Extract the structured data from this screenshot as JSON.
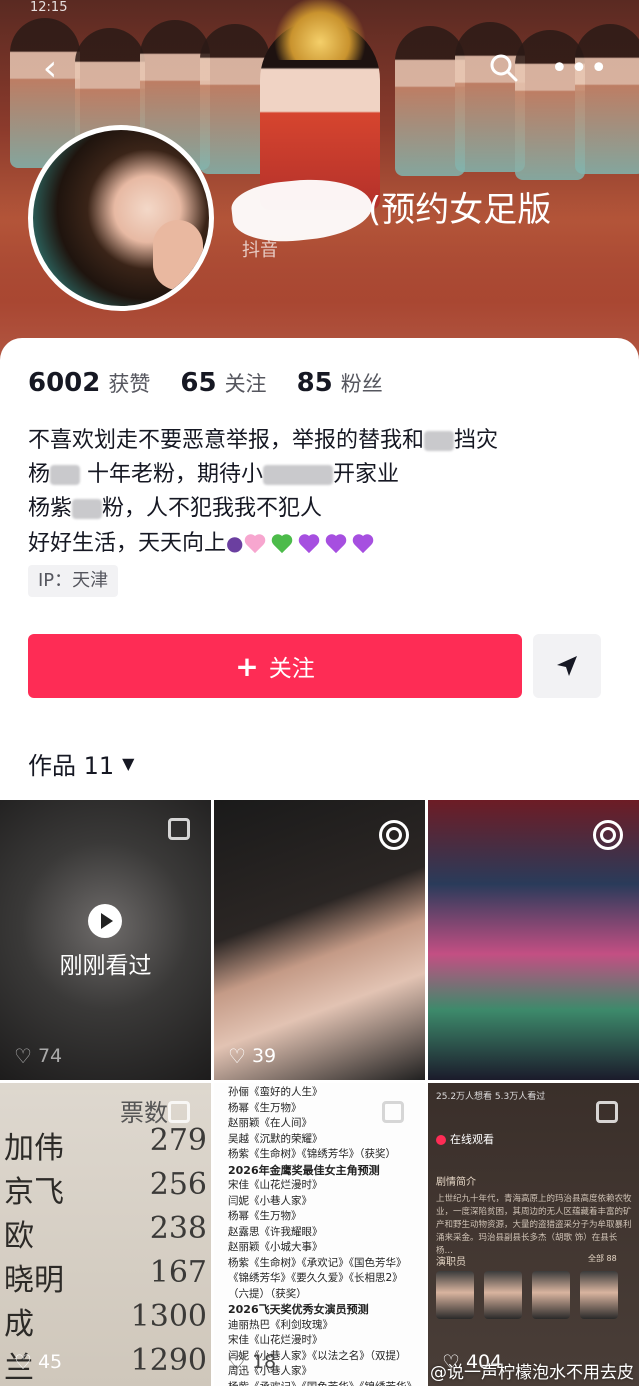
{
  "status_bar": {
    "time": "12:15"
  },
  "profile": {
    "nickname_suffix": "(预约女足版",
    "platform_tag": "抖音",
    "stats": [
      {
        "value": "6002",
        "label": "获赞"
      },
      {
        "value": "65",
        "label": "关注"
      },
      {
        "value": "85",
        "label": "粉丝"
      }
    ],
    "bio": {
      "line1": "不喜欢划走不要恶意举报，举报的替我和",
      "line1_end": "挡灾",
      "line2_start": "杨",
      "line2_mid": " 十年老粉，期待小",
      "line2_end": "开家业",
      "line3_start": "杨紫",
      "line3_end": "粉，人不犯我我不犯人",
      "line4": "好好生活，天天向上"
    },
    "ip": "IP：天津"
  },
  "actions": {
    "follow_label": "关注",
    "follow_plus": "+"
  },
  "works_tab": {
    "label": "作品 11",
    "caret": "▼"
  },
  "grid": {
    "tile1": {
      "overlay": "刚刚看过",
      "likes": "74"
    },
    "tile2": {
      "likes": "39"
    },
    "tile4": {
      "header": "票数",
      "rows": [
        {
          "name": "加伟",
          "num": "279"
        },
        {
          "name": "京飞",
          "num": "256"
        },
        {
          "name": "欧",
          "num": "238"
        },
        {
          "name": "晓明",
          "num": "167"
        },
        {
          "name": "成",
          "num": "1300"
        },
        {
          "name": "兰",
          "num": "1290"
        }
      ],
      "likes": "45"
    },
    "tile5": {
      "lines": [
        "孙俪《蛮好的人生》",
        "杨幂《生万物》",
        "赵丽颖《在人间》",
        "吴越《沉默的荣耀》",
        "杨紫《生命树》《锦绣芳华》（获奖）",
        "2026年金鹰奖最佳女主角预测",
        "宋佳《山花烂漫时》",
        "闫妮《小巷人家》",
        "杨幂《生万物》",
        "赵露思《许我耀眼》",
        "赵丽颖《小城大事》",
        "杨紫《生命树》《承欢记》《国色芳华》《锦绣芳华》《要久久爱》《长相思2》（六提）（获奖）",
        "2026飞天奖优秀女演员预测",
        "迪丽热巴《利剑玫瑰》",
        "宋佳《山花烂漫时》",
        "闫妮《小巷人家》《以法之名》（双提）",
        "周迅《小巷人家》",
        "杨紫《承欢记》《国色芳华》《锦绣芳华》"
      ],
      "bold_indexes": [
        5,
        12
      ],
      "likes": "18"
    },
    "tile6": {
      "top_meta": "25.2万人想看  5.3万人看过",
      "live_label": "在线观看",
      "synopsis_title": "剧情简介",
      "synopsis": "上世纪九十年代，青海高原上的玛治县高度依赖农牧业，一度深陷贫困，其周边的无人区蕴藏着丰富的矿产和野生动物资源，大量的盗猎盗采分子为牟取暴利涌来采金。玛治县副县长多杰（胡歌 饰）在县长杨…",
      "cast_title": "演职员",
      "cast_more": "全部 88",
      "likes": "404"
    }
  },
  "watermark": "@说一声柠檬泡水不用去皮",
  "colors": {
    "accent": "#fe2c55",
    "text": "#161823",
    "secondary": "#55565e"
  }
}
